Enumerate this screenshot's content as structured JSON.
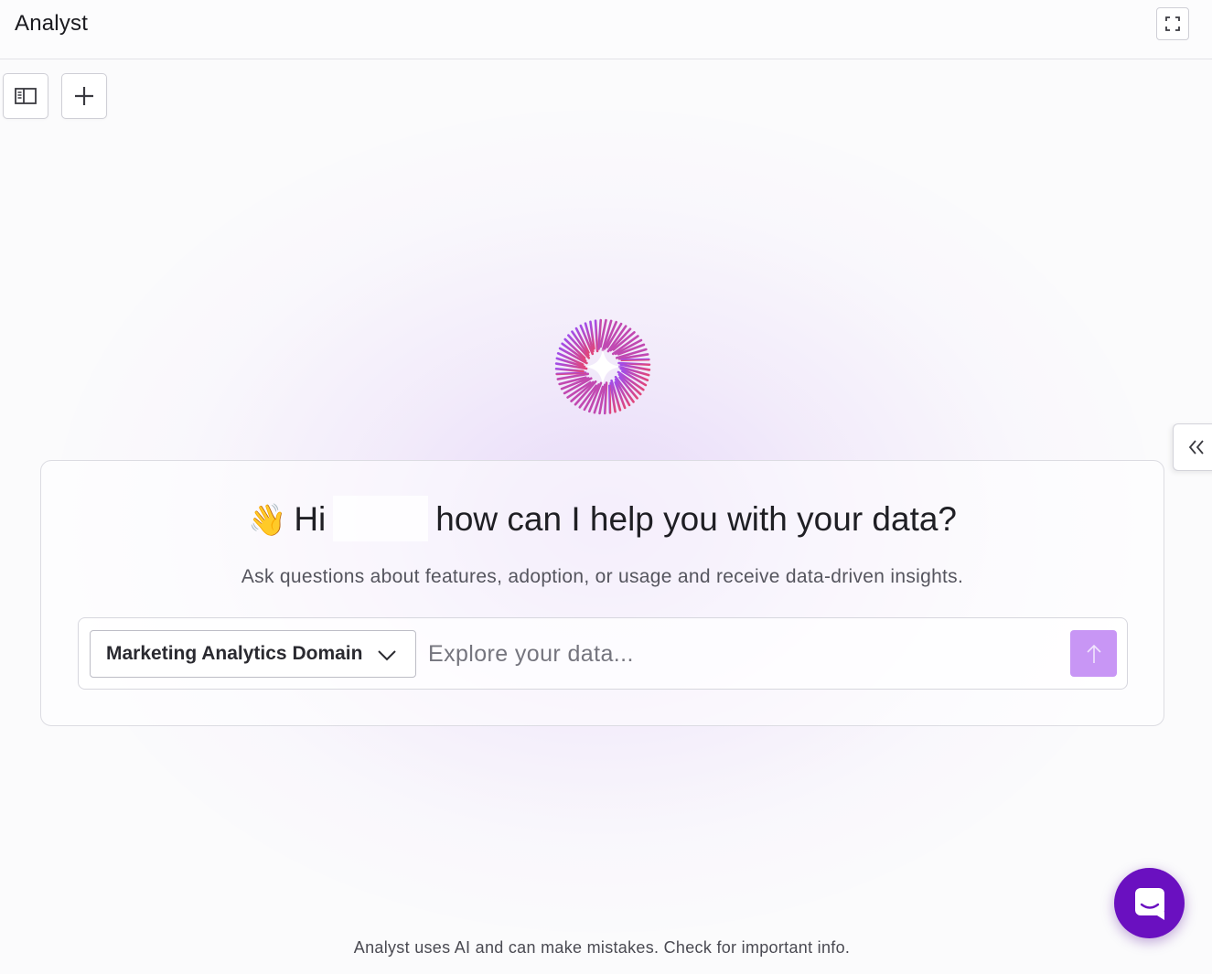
{
  "header": {
    "title": "Analyst",
    "fullscreen_icon": "expand-icon"
  },
  "toolbar": {
    "sidebar_icon": "sidebar-toggle-icon",
    "new_chat_icon": "plus-icon"
  },
  "panel": {
    "collapse_icon": "double-chevron-left-icon"
  },
  "hero": {
    "logo_icon": "starburst-sparkle-icon",
    "logo_colors": [
      "#a24de8",
      "#e0457a"
    ]
  },
  "card": {
    "wave_emoji": "👋",
    "greeting_hi": "Hi",
    "greeting_rest": "how can I help you with your data?",
    "subtitle": "Ask questions about features, adoption, or usage and receive data-driven insights.",
    "domain_select": {
      "selected": "Marketing Analytics Domain"
    },
    "input": {
      "value": "",
      "placeholder": "Explore your data..."
    },
    "send_icon": "arrow-up-icon"
  },
  "footer": {
    "disclaimer": "Analyst uses AI and can make mistakes. Check for important info."
  },
  "launcher": {
    "icon": "chat-bubble-icon"
  },
  "colors": {
    "accent": "#6a10c0",
    "send_button": "#c896f5",
    "background": "#fbfbfc"
  }
}
